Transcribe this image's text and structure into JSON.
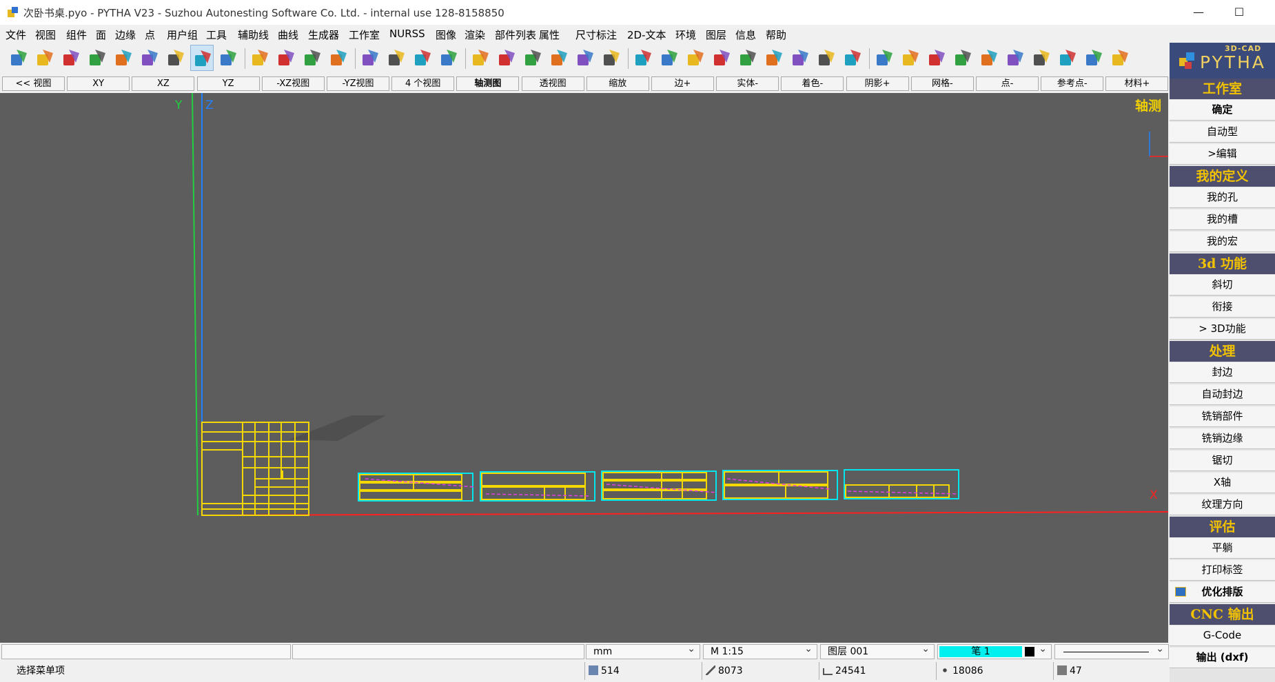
{
  "window": {
    "title": "次卧书桌.pyo - PYTHA V23 - Suzhou Autonesting Software Co. Ltd. - internal use   128-8158850",
    "min_glyph": "—",
    "max_glyph": "☐"
  },
  "menu": [
    "文件",
    "视图",
    "组件",
    "面",
    "边缘",
    "点",
    "用户组",
    "工具",
    "辅助线",
    "曲线",
    "生成器",
    "工作室",
    "NURSS",
    "图像",
    "渲染",
    "部件列表",
    "属性",
    "尺寸标注",
    "2D-文本",
    "环境",
    "图层",
    "信息",
    "帮助"
  ],
  "toolbar": {
    "icons": [
      "cube-icon",
      "prism-icon",
      "triangle-icon",
      "stars-icon",
      "compass-icon",
      "curve-icon",
      "gears-icon",
      "drill-icon",
      "fold-icon",
      "hammer-icon",
      "hammer2-icon",
      "hammer3-icon",
      "hammer4-icon",
      "camera-icon",
      "lamp-icon",
      "eye-icon",
      "printer-icon",
      "upload-icon",
      "download-icon",
      "hook-icon",
      "cup-icon",
      "undo-icon",
      "redo-icon",
      "attr-icon",
      "parts-list-icon",
      "layers-lines-icon",
      "hundred-icon",
      "document-icon",
      "hatch-icon",
      "layer-stack-icon",
      "tree-icon",
      "info-icon",
      "refresh-icon",
      "delete-icon",
      "move-box-icon",
      "boxes-icon",
      "rotate-box-icon",
      "treasure-icon",
      "tube-icon",
      "stamp-icon",
      "cheese-icon",
      "scissors-icon"
    ],
    "active_index": 7
  },
  "viewbar": [
    "<< 视图",
    "XY",
    "XZ",
    "YZ",
    "-XZ视图",
    "-YZ视图",
    "4 个视图",
    "轴测图",
    "透视图",
    "缩放",
    "边+",
    "实体-",
    "着色-",
    "阴影+",
    "网格-",
    "点-",
    "参考点-",
    "材料+"
  ],
  "viewbar_bold_index": 7,
  "viewport": {
    "view_name": "轴测",
    "axis_y": "Y",
    "axis_z": "Z",
    "axis_x": "X",
    "colors": {
      "background": "#5d5d5d",
      "parts": "#f5d800",
      "cyan": "#00e5ee",
      "magenta": "#e040e0",
      "x_axis": "#ff2020",
      "y_axis": "#20d040",
      "z_axis": "#2080ff"
    }
  },
  "right_panel": {
    "logo_top": "3D-CAD",
    "logo_main": "PYTHA",
    "sections": [
      {
        "title": "工作室",
        "buttons": [
          {
            "label": "确定",
            "bold": true
          },
          {
            "label": "自动型"
          },
          {
            "label": ">编辑"
          }
        ]
      },
      {
        "title": "我的定义",
        "buttons": [
          {
            "label": "我的孔"
          },
          {
            "label": "我的槽"
          },
          {
            "label": "我的宏"
          }
        ]
      },
      {
        "title": "3d 功能",
        "buttons": [
          {
            "label": "斜切"
          },
          {
            "label": "衔接"
          },
          {
            "label": "> 3D功能"
          }
        ]
      },
      {
        "title": "处理",
        "buttons": [
          {
            "label": "封边"
          },
          {
            "label": "自动封边"
          },
          {
            "label": "铣销部件"
          },
          {
            "label": "铣销边缘"
          },
          {
            "label": "锯切"
          },
          {
            "label": "X轴"
          },
          {
            "label": "纹理方向"
          }
        ]
      },
      {
        "title": "评估",
        "buttons": [
          {
            "label": "平躺"
          },
          {
            "label": "打印标签"
          },
          {
            "label": "优化排版",
            "bold": true,
            "icon": "nesting-icon"
          }
        ]
      },
      {
        "title": "CNC 输出",
        "buttons": [
          {
            "label": "G-Code"
          },
          {
            "label": "输出 (dxf)",
            "bold": true
          }
        ]
      }
    ]
  },
  "status": {
    "message": "选择菜单项",
    "unit": "mm",
    "scale": "M 1:15",
    "layer": "图层 001",
    "pen": "笔 1",
    "pen_color": "#00f0f0",
    "counters": [
      {
        "icon": "cube-count-icon",
        "value": "514"
      },
      {
        "icon": "face-count-icon",
        "value": "8073"
      },
      {
        "icon": "edge-count-icon",
        "value": "24541"
      },
      {
        "icon": "point-count-icon",
        "value": "18086"
      },
      {
        "icon": "group-count-icon",
        "value": "47"
      }
    ]
  }
}
